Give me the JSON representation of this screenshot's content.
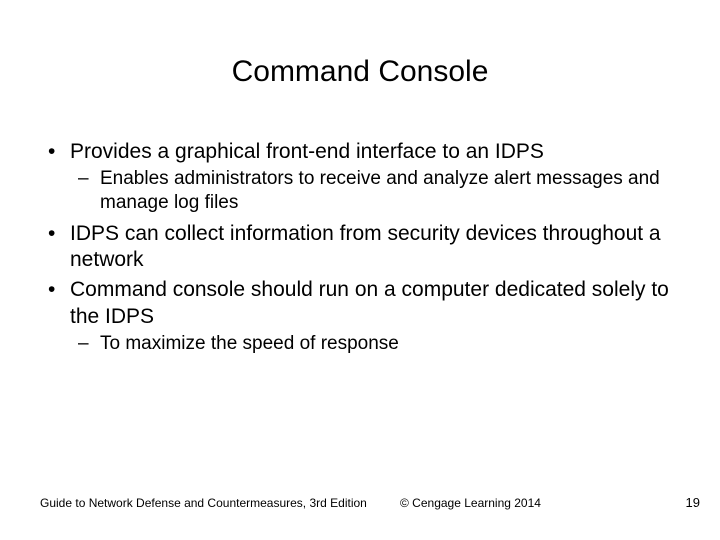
{
  "title": "Command Console",
  "bullets": {
    "b1": "Provides a graphical front-end interface to an IDPS",
    "b1_1": "Enables administrators to receive and analyze alert messages and manage log files",
    "b2": "IDPS can collect information from security devices throughout a network",
    "b3": "Command console should run on a computer dedicated solely to the IDPS",
    "b3_1": "To maximize the speed of response"
  },
  "footer": {
    "left": "Guide to Network Defense and Countermeasures, 3rd Edition",
    "center": "© Cengage Learning 2014",
    "right": "19"
  }
}
